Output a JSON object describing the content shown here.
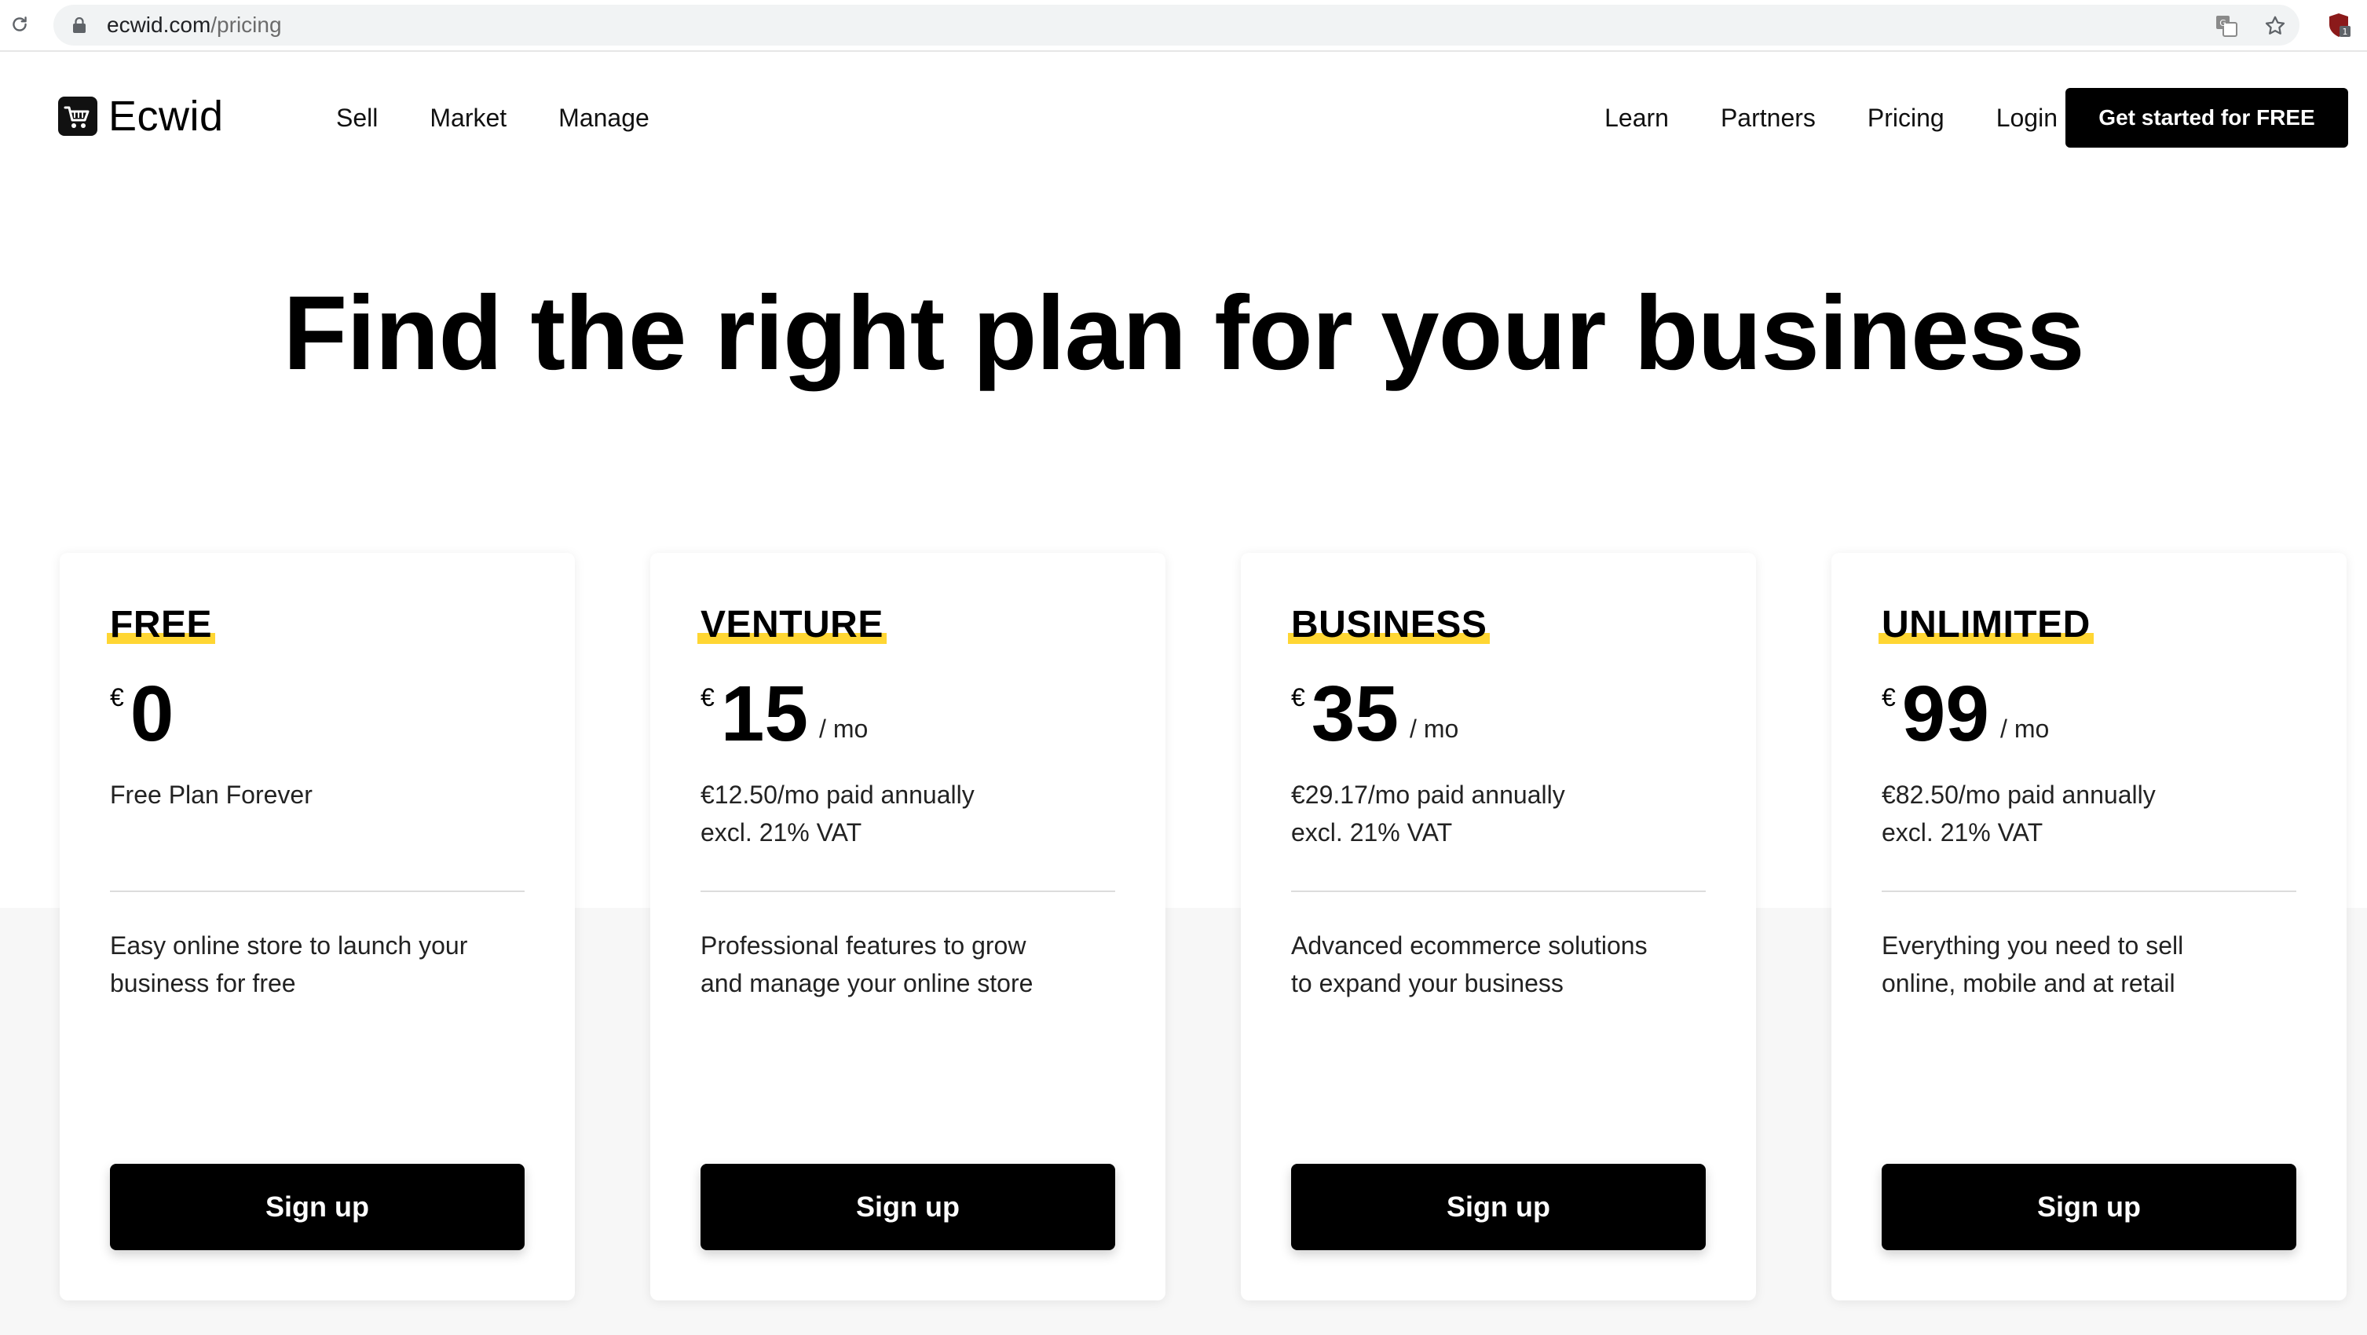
{
  "browser": {
    "url_host": "ecwid.com",
    "url_path": "/pricing",
    "extension_badge": "1"
  },
  "header": {
    "logo_text": "Ecwid",
    "nav_left": [
      "Sell",
      "Market",
      "Manage"
    ],
    "nav_right": [
      "Learn",
      "Partners",
      "Pricing",
      "Login"
    ],
    "cta_label": "Get started for FREE"
  },
  "hero": {
    "title": "Find the right plan for your business"
  },
  "plans": [
    {
      "name": "FREE",
      "currency": "€",
      "price": "0",
      "per": "",
      "sub_line1": "Free Plan Forever",
      "sub_line2": "",
      "desc_line1": "Easy online store to launch your",
      "desc_line2": "business for free",
      "button": "Sign up"
    },
    {
      "name": "VENTURE",
      "currency": "€",
      "price": "15",
      "per": "/ mo",
      "sub_line1": "€12.50/mo paid annually",
      "sub_line2": "excl. 21% VAT",
      "desc_line1": "Professional features to grow",
      "desc_line2": "and manage your online store",
      "button": "Sign up"
    },
    {
      "name": "BUSINESS",
      "currency": "€",
      "price": "35",
      "per": "/ mo",
      "sub_line1": "€29.17/mo paid annually",
      "sub_line2": "excl. 21% VAT",
      "desc_line1": "Advanced ecommerce solutions",
      "desc_line2": "to expand your business",
      "button": "Sign up"
    },
    {
      "name": "UNLIMITED",
      "currency": "€",
      "price": "99",
      "per": "/ mo",
      "sub_line1": "€82.50/mo paid annually",
      "sub_line2": "excl. 21% VAT",
      "desc_line1": "Everything you need to sell",
      "desc_line2": "online, mobile and at retail",
      "button": "Sign up"
    }
  ],
  "colors": {
    "accent_highlight": "#ffd633",
    "button_bg": "#000000",
    "band_bg": "#f7f7f7"
  }
}
